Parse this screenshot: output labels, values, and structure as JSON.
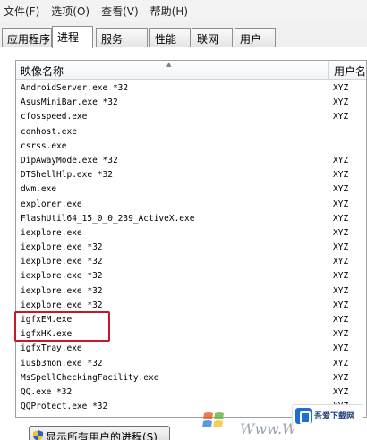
{
  "menubar": {
    "items": [
      "文件(F)",
      "选项(O)",
      "查看(V)",
      "帮助(H)"
    ]
  },
  "tabs": [
    {
      "label": "应用程序",
      "active": false
    },
    {
      "label": "进程",
      "active": true
    },
    {
      "label": "服务",
      "active": false
    },
    {
      "label": "性能",
      "active": false
    },
    {
      "label": "联网",
      "active": false
    },
    {
      "label": "用户",
      "active": false
    }
  ],
  "list": {
    "columns": {
      "name": "映像名称",
      "user": "用户名"
    },
    "rows": [
      {
        "name": "AndroidServer.exe *32",
        "user": "XYZ"
      },
      {
        "name": "AsusMiniBar.exe *32",
        "user": "XYZ"
      },
      {
        "name": "cfosspeed.exe",
        "user": "XYZ"
      },
      {
        "name": "conhost.exe",
        "user": ""
      },
      {
        "name": "csrss.exe",
        "user": ""
      },
      {
        "name": "DipAwayMode.exe *32",
        "user": "XYZ"
      },
      {
        "name": "DTShellHlp.exe *32",
        "user": "XYZ"
      },
      {
        "name": "dwm.exe",
        "user": "XYZ"
      },
      {
        "name": "explorer.exe",
        "user": "XYZ"
      },
      {
        "name": "FlashUtil64_15_0_0_239_ActiveX.exe",
        "user": "XYZ"
      },
      {
        "name": "iexplore.exe",
        "user": "XYZ"
      },
      {
        "name": "iexplore.exe *32",
        "user": "XYZ"
      },
      {
        "name": "iexplore.exe *32",
        "user": "XYZ"
      },
      {
        "name": "iexplore.exe *32",
        "user": "XYZ"
      },
      {
        "name": "iexplore.exe *32",
        "user": "XYZ"
      },
      {
        "name": "iexplore.exe *32",
        "user": "XYZ"
      },
      {
        "name": "igfxEM.exe",
        "user": "XYZ"
      },
      {
        "name": "igfxHK.exe",
        "user": "XYZ"
      },
      {
        "name": "igfxTray.exe",
        "user": "XYZ"
      },
      {
        "name": "iusb3mon.exe *32",
        "user": "XYZ"
      },
      {
        "name": "MsSpellCheckingFacility.exe",
        "user": "XYZ"
      },
      {
        "name": "QQ.exe *32",
        "user": "XYZ"
      },
      {
        "name": "QQProtect.exe *32",
        "user": "XYZ"
      }
    ]
  },
  "show_all_button": {
    "label": "显示所有用户的进程(S)"
  },
  "watermark": {
    "text": "Www.W",
    "logo_text": "吾爱下载网"
  },
  "colors": {
    "highlight": "#c8182c",
    "border": "#a0a0a0"
  },
  "icons": {
    "sort": "sort-up-icon",
    "shield": "uac-shield-icon"
  }
}
